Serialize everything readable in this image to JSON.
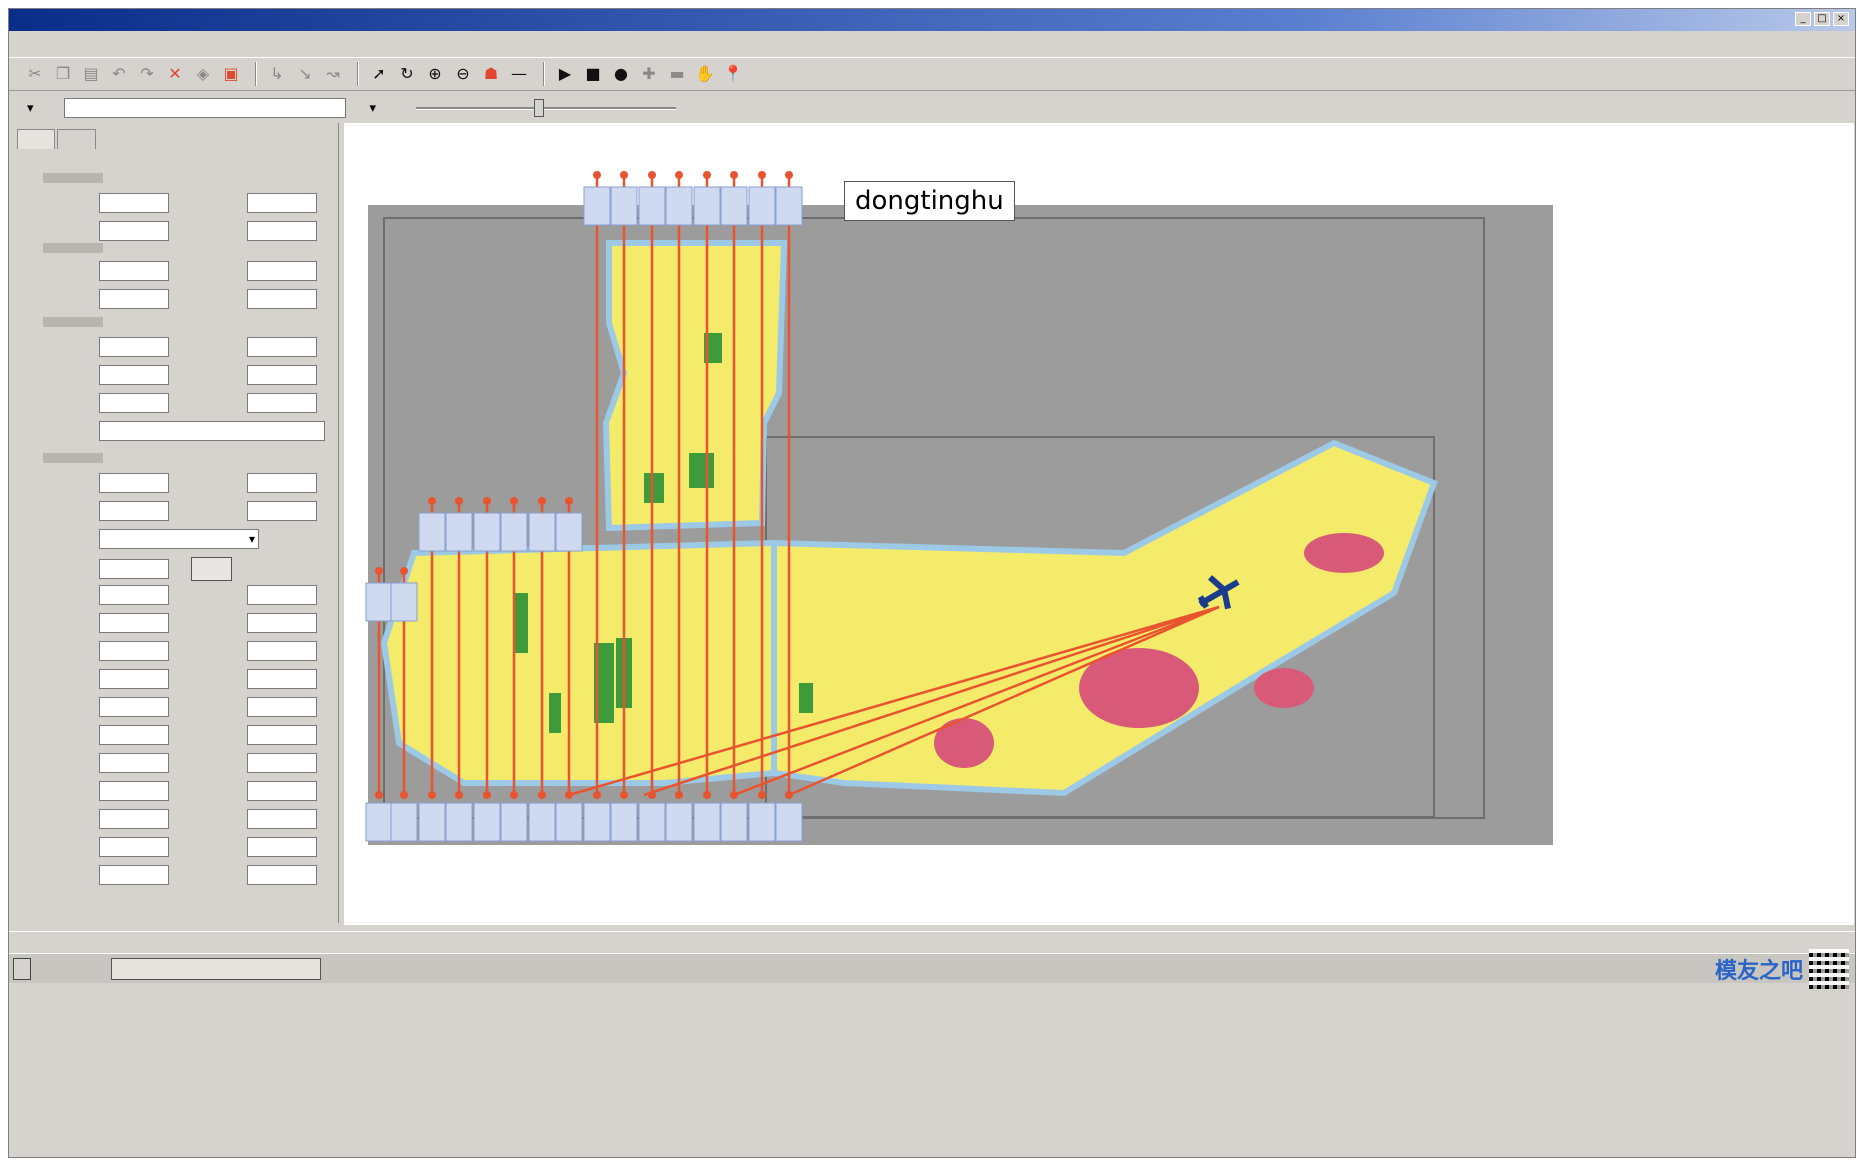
{
  "window": {
    "title": "",
    "min": "_",
    "max": "□",
    "close": "×"
  },
  "menu": [
    "",
    "",
    "",
    "",
    "",
    "",
    ""
  ],
  "toolbar": {
    "icons": [
      "cut-icon",
      "copy-icon",
      "paste-icon",
      "undo-icon",
      "redo-icon",
      "delete-icon",
      "disk-icon",
      "save-icon",
      "line-icon",
      "arrow-icon",
      "pointer-icon",
      "rotate-icon",
      "zoom-in-icon",
      "zoom-out-icon",
      "figure-icon",
      "dash-icon",
      "play-icon",
      "stop-icon",
      "record-icon",
      "plus-icon",
      "minus-icon",
      "pan-icon",
      "pin-icon"
    ]
  },
  "map": {
    "title": "dongtinghu",
    "colors": {
      "water": "#9cc9e6",
      "farmland": "#f5eb6a",
      "forest": "#3e9a3a",
      "urban": "#d85a78",
      "route": "#e8542f",
      "background": "#9c9c9c"
    }
  },
  "statusbar": {
    "text": ""
  },
  "taskbar": {
    "start": "",
    "task": "",
    "watermark": "模友之吧"
  }
}
